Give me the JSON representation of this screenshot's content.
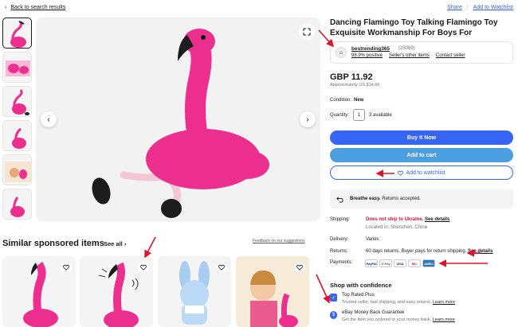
{
  "nav": {
    "back_label": "Back to search results",
    "share": "Share",
    "separator": "|",
    "add_to_watchlist": "Add to Watchlist"
  },
  "product": {
    "title": "Dancing Flamingo Toy Talking Flamingo Toy Exquisite Workmanship For Boys For",
    "price": "GBP 11.92",
    "approx_price": "Approximately US $14.66",
    "condition_label": "Condition:",
    "condition_value": "New",
    "quantity_label": "Quantity:",
    "quantity_value": "1",
    "available": "3 available"
  },
  "seller": {
    "name": "bestrending365",
    "score": "(25069)",
    "positive": "98.9% positive",
    "other_items": "Seller's other items",
    "contact": "Contact seller",
    "separator": "·"
  },
  "buttons": {
    "buy": "Buy It Now",
    "cart": "Add to cart",
    "watch": "Add to watchlist"
  },
  "returns_banner": {
    "bold": "Breathe easy.",
    "text": "Returns accepted."
  },
  "details": {
    "shipping_label": "Shipping:",
    "shipping_red": "Does not ship to Ukraine.",
    "shipping_link": "See details",
    "location": "Located in: Shenzhen, China",
    "delivery_label": "Delivery:",
    "delivery_value": "Varies",
    "returns_label": "Returns:",
    "returns_value": "60 days returns. Buyer pays for return shipping.",
    "returns_link": "See details",
    "payments_label": "Payments:",
    "payment_methods": [
      "PayPal",
      "G Pay",
      "VISA",
      "MC",
      "AMEX"
    ]
  },
  "confidence": {
    "title": "Shop with confidence",
    "items": [
      {
        "title": "Top Rated Plus",
        "sub": "Trusted seller, fast shipping, and easy returns.",
        "link": "Learn more"
      },
      {
        "title": "eBay Money Back Guarantee",
        "sub": "Get the item you ordered or your money back.",
        "link": "Learn more"
      }
    ]
  },
  "similar": {
    "title": "Similar sponsored items",
    "see_all": "See all",
    "feedback": "Feedback on our suggestions"
  },
  "colors": {
    "accent": "#3665f3",
    "cart": "#4b9fe0",
    "red": "#e0103a",
    "flamingo": "#ec2f8e",
    "annotation_arrow": "#e0102a"
  }
}
